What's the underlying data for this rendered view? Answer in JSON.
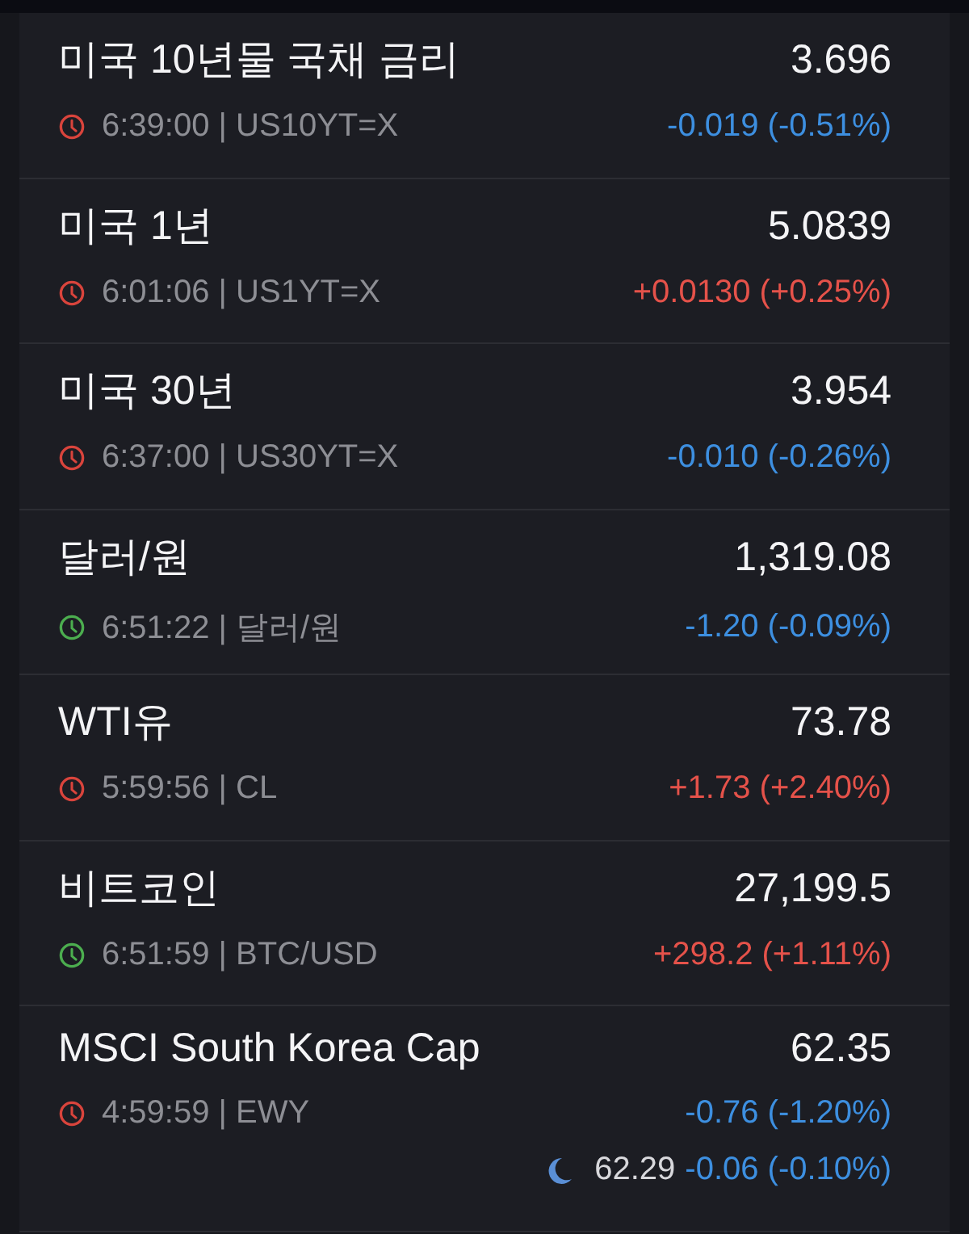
{
  "quotes": [
    {
      "name": "미국 10년물 국채 금리",
      "price": "3.696",
      "market_open": false,
      "meta": "6:39:00 | US10YT=X",
      "color": "#3d8fe0",
      "change": "-0.019 (-0.51%)"
    },
    {
      "name": "미국 1년",
      "price": "5.0839",
      "market_open": false,
      "meta": "6:01:06 | US1YT=X",
      "color": "#e5524a",
      "change": "+0.0130 (+0.25%)"
    },
    {
      "name": "미국 30년",
      "price": "3.954",
      "market_open": false,
      "meta": "6:37:00 | US30YT=X",
      "color": "#3d8fe0",
      "change": "-0.010 (-0.26%)"
    },
    {
      "name": "달러/원",
      "price": "1,319.08",
      "market_open": true,
      "meta": "6:51:22 | 달러/원",
      "color": "#3d8fe0",
      "change": "-1.20 (-0.09%)"
    },
    {
      "name": "WTI유",
      "price": "73.78",
      "market_open": false,
      "meta": "5:59:56 | CL",
      "color": "#e5524a",
      "change": "+1.73 (+2.40%)"
    },
    {
      "name": "비트코인",
      "price": "27,199.5",
      "market_open": true,
      "meta": "6:51:59 | BTC/USD",
      "color": "#e5524a",
      "change": "+298.2 (+1.11%)"
    },
    {
      "name": "MSCI South Korea Cap",
      "price": "62.35",
      "market_open": false,
      "meta": "4:59:59 | EWY",
      "color": "#3d8fe0",
      "change": "-0.76 (-1.20%)",
      "after_hours": {
        "price": "62.29",
        "color": "#3d8fe0",
        "change": "-0.06 (-0.10%)"
      }
    }
  ]
}
